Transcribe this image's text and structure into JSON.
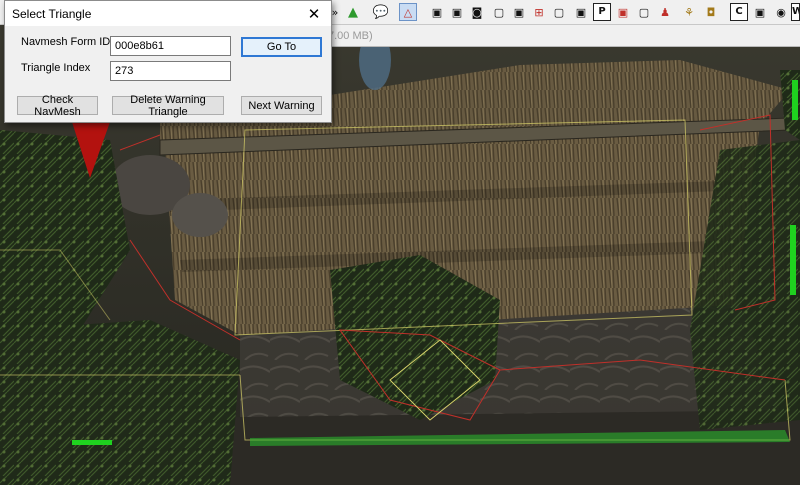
{
  "dialog": {
    "title": "Select Triangle",
    "navmesh_label": "Navmesh Form ID",
    "navmesh_value": "000e8b61",
    "triangle_label": "Triangle Index",
    "triangle_value": "273",
    "goto_label": "Go To",
    "check_label": "Check NavMesh",
    "delete_label": "Delete Warning Triangle",
    "next_label": "Next Warning"
  },
  "toolbar": {
    "visible_fragment": "»",
    "memory_text": "7.00 MB)",
    "icons": [
      "grass-icon",
      "speech-bubble-icon",
      "navmesh-icon",
      "cube-icon",
      "cube-icon",
      "cube-icon",
      "marker-icon",
      "cube-icon",
      "grid-icon",
      "cube-icon",
      "cube-icon",
      "P",
      "picture-icon",
      "cube-icon",
      "person-icon",
      "tree-icon",
      "camera-icon",
      "C",
      "cube-icon",
      "globe-icon",
      "W"
    ],
    "letter_buttons": [
      "P",
      "C",
      "W"
    ]
  },
  "colors": {
    "dialog_bg": "#f0f0f0",
    "default_button_border": "#2f78d4",
    "navmesh_edge_red": "#c0302a",
    "navmesh_edge_green": "#29c02d",
    "navmesh_edge_yellow": "#d8d26a"
  }
}
